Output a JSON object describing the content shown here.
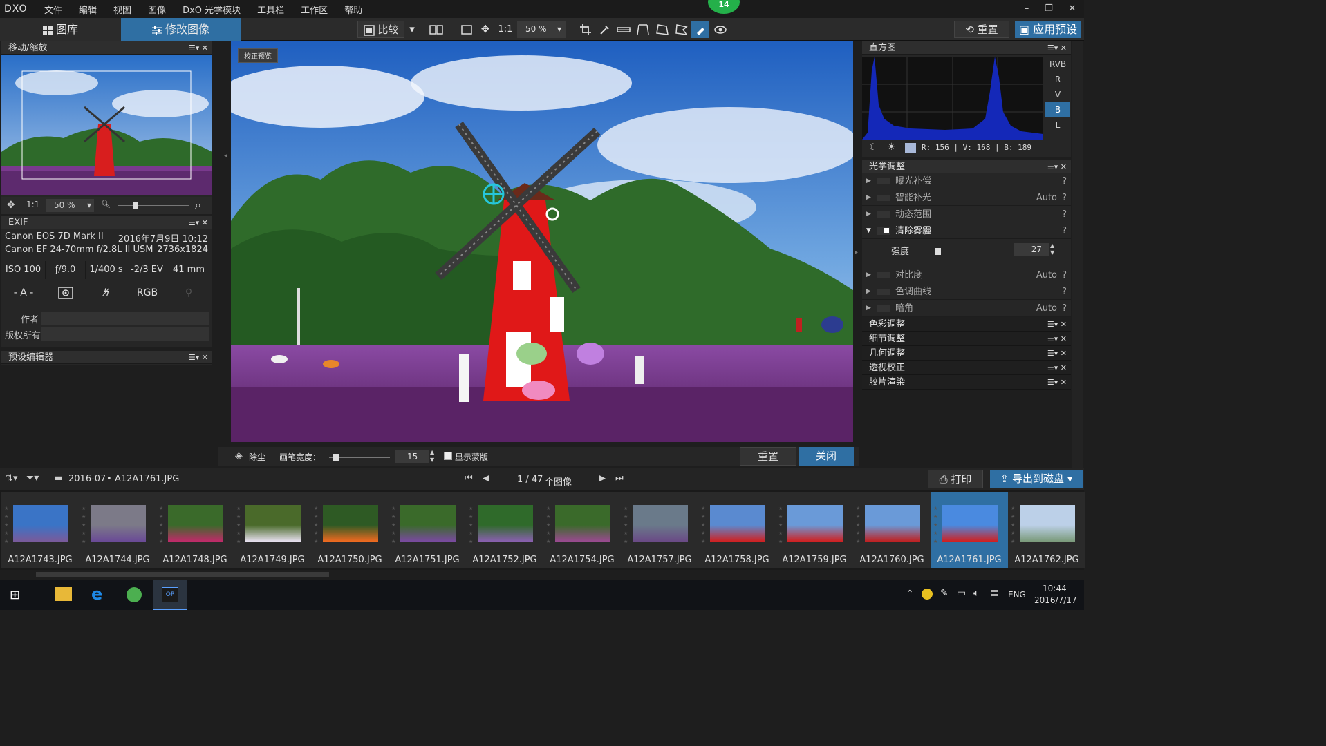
{
  "app": {
    "logo": "DXO",
    "menu": [
      "文件",
      "编辑",
      "视图",
      "图像",
      "DxO 光学模块",
      "工具栏",
      "工作区",
      "帮助"
    ],
    "badge": "14"
  },
  "toolbar": {
    "library": "图库",
    "customize": "修改图像",
    "compare": "比较",
    "one_to_one": "1:1",
    "zoom": "50 %",
    "reset": "重置",
    "apply_preset": "应用预设"
  },
  "nav": {
    "title": "移动/缩放",
    "one_to_one": "1:1",
    "zoom": "50 %"
  },
  "exif": {
    "title": "EXIF",
    "camera": "Canon EOS 7D Mark II",
    "date": "2016年7月9日 10:12",
    "lens": "Canon EF 24-70mm f/2.8L II USM",
    "size": "2736x1824",
    "iso": "ISO 100",
    "aperture": "ƒ/9.0",
    "shutter": "1/400 s",
    "ev": "-2/3 EV",
    "focal": "41 mm",
    "mode": "- A -",
    "rgb": "RGB",
    "author_label": "作者",
    "copyright_label": "版权所有",
    "author_value": "",
    "copyright_value": ""
  },
  "preset_editor": {
    "title": "预设编辑器"
  },
  "viewer": {
    "preview_label": "校正预览"
  },
  "dust": {
    "tool": "除尘",
    "brush_label": "画笔宽度：",
    "brush_value": "15",
    "show_mask": "显示蒙版",
    "reset": "重置",
    "close": "关闭"
  },
  "histogram": {
    "title": "直方图",
    "channels": [
      "RVB",
      "R",
      "V",
      "B",
      "L"
    ],
    "selected": "B",
    "readout": "R: 156 | V: 168 | B: 189"
  },
  "optical": {
    "title": "光学调整",
    "items": [
      {
        "label": "曝光补偿",
        "value": ""
      },
      {
        "label": "智能补光",
        "value": "Auto"
      },
      {
        "label": "动态范围",
        "value": ""
      },
      {
        "label": "清除雾霾",
        "value": ""
      },
      {
        "label": "对比度",
        "value": "Auto"
      },
      {
        "label": "色调曲线",
        "value": ""
      },
      {
        "label": "暗角",
        "value": "Auto"
      }
    ],
    "strength_label": "强度",
    "strength_value": "27",
    "help": "?"
  },
  "palettes": [
    "色彩调整",
    "细节调整",
    "几何调整",
    "透视校正",
    "胶片渲染"
  ],
  "filmstrip": {
    "folder": "2016-07",
    "file": "A12A1761.JPG",
    "counter": "1 / 47",
    "count_label": "个图像",
    "print": "打印",
    "export": "导出到磁盘",
    "files": [
      "A12A1743.JPG",
      "A12A1744.JPG",
      "A12A1748.JPG",
      "A12A1749.JPG",
      "A12A1750.JPG",
      "A12A1751.JPG",
      "A12A1752.JPG",
      "A12A1754.JPG",
      "A12A1757.JPG",
      "A12A1758.JPG",
      "A12A1759.JPG",
      "A12A1760.JPG",
      "A12A1761.JPG",
      "A12A1762.JPG"
    ],
    "selected_index": 12
  },
  "taskbar": {
    "lang": "ENG",
    "time": "10:44",
    "date": "2016/7/17"
  }
}
